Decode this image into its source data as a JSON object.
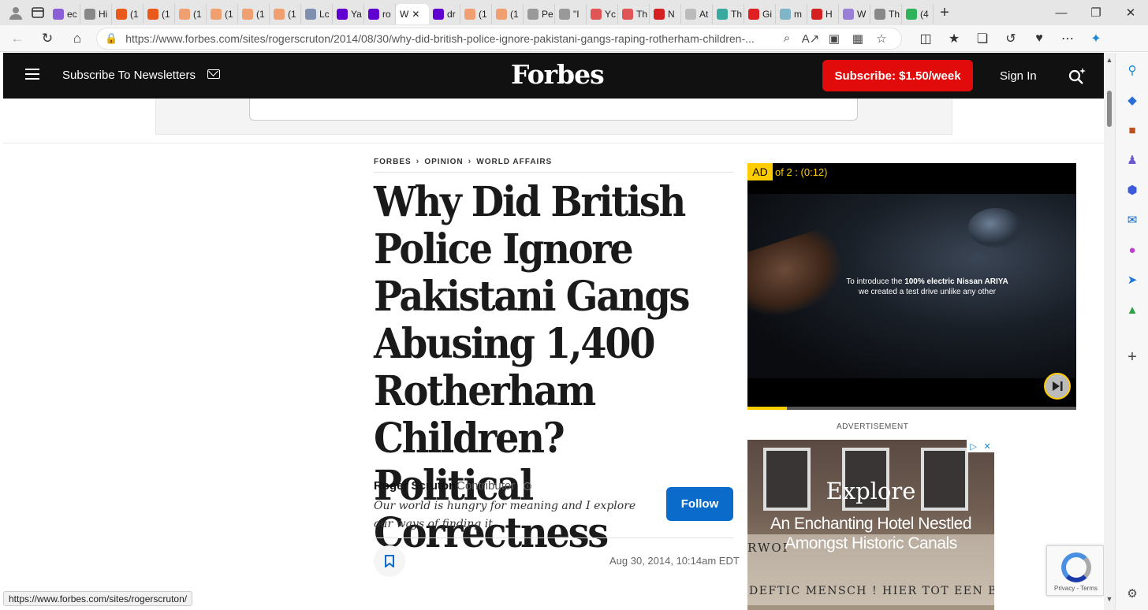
{
  "browser": {
    "tabs": [
      {
        "label": "ec",
        "color": "#8b5fd6"
      },
      {
        "label": "Hi",
        "color": "#888888"
      },
      {
        "label": "(1",
        "color": "#e8591a"
      },
      {
        "label": "(1",
        "color": "#e8591a"
      },
      {
        "label": "(1",
        "color": "#f0a070"
      },
      {
        "label": "(1",
        "color": "#f0a070"
      },
      {
        "label": "(1",
        "color": "#f0a070"
      },
      {
        "label": "(1",
        "color": "#f0a070"
      },
      {
        "label": "Lc",
        "color": "#7f8fb0"
      },
      {
        "label": "Ya",
        "color": "#6001d2"
      },
      {
        "label": "ro",
        "color": "#6001d2"
      },
      {
        "label": "W",
        "color": "#ffffff",
        "active": true
      },
      {
        "label": "dr",
        "color": "#6001d2"
      },
      {
        "label": "(1",
        "color": "#f0a070"
      },
      {
        "label": "(1",
        "color": "#f0a070"
      },
      {
        "label": "Pe",
        "color": "#999999"
      },
      {
        "label": "\"I",
        "color": "#999999"
      },
      {
        "label": "Yc",
        "color": "#e05555"
      },
      {
        "label": "Th",
        "color": "#e05555"
      },
      {
        "label": "N",
        "color": "#d42020"
      },
      {
        "label": "At",
        "color": "#bbbbbb"
      },
      {
        "label": "Th",
        "color": "#3aa99f"
      },
      {
        "label": "Gi",
        "color": "#e02020"
      },
      {
        "label": "m",
        "color": "#7fb5c8"
      },
      {
        "label": "H",
        "color": "#d42020"
      },
      {
        "label": "W",
        "color": "#9a7fd6"
      },
      {
        "label": "Th",
        "color": "#888888"
      },
      {
        "label": "(4",
        "color": "#2fb35a"
      }
    ],
    "url": "https://www.forbes.com/sites/rogerscruton/2014/08/30/why-did-british-police-ignore-pakistani-gangs-raping-rotherham-children-...",
    "status_url": "https://www.forbes.com/sites/rogerscruton/"
  },
  "header": {
    "subscribe_newsletters": "Subscribe To Newsletters",
    "logo": "Forbes",
    "subscribe_button": "Subscribe: $1.50/week",
    "sign_in": "Sign In"
  },
  "article": {
    "breadcrumb": [
      "FORBES",
      "OPINION",
      "WORLD AFFAIRS"
    ],
    "headline": "Why Did British Police Ignore Pakistani Gangs Abusing 1,400 Rotherham Children? Political Correctness",
    "author": "Roger Scruton",
    "author_role": "Contributor",
    "bio": "Our world is hungry for meaning and I explore our ways of finding it.",
    "follow": "Follow",
    "date": "Aug 30, 2014, 10:14am EDT"
  },
  "video_ad": {
    "ad_badge": "AD",
    "counter": "of 2 : (0:12)",
    "caption_pre": "To introduce the ",
    "caption_bold": "100% electric Nissan ARIYA",
    "caption_post": "we created a test drive unlike any other",
    "progress": 0.12
  },
  "advertisement_label": "ADVERTISEMENT",
  "hotel_ad": {
    "title": "Explore",
    "subtitle": "An Enchanting Hotel Nestled Amongst Historic Canals",
    "sign_text_1": "RWOI",
    "sign_text_2": "DEFTIC MENSCH ! HIER TOT EEN BA"
  },
  "recaptcha": {
    "terms": "Privacy - Terms"
  }
}
